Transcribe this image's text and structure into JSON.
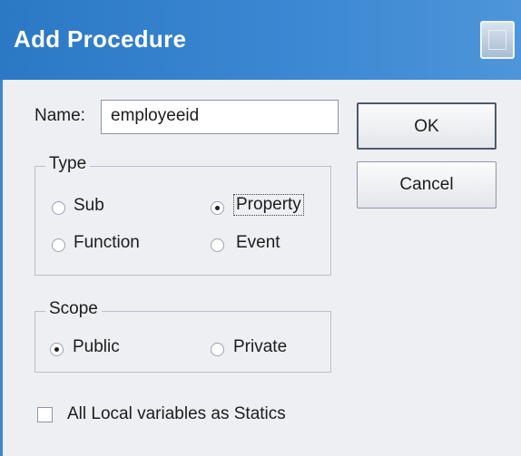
{
  "window": {
    "title": "Add Procedure"
  },
  "name_field": {
    "label": "Name:",
    "value": "employeeid"
  },
  "buttons": {
    "ok": "OK",
    "cancel": "Cancel"
  },
  "type_group": {
    "title": "Type",
    "options": [
      {
        "label": "Sub",
        "selected": false
      },
      {
        "label": "Property",
        "selected": true
      },
      {
        "label": "Function",
        "selected": false
      },
      {
        "label": "Event",
        "selected": false
      }
    ]
  },
  "scope_group": {
    "title": "Scope",
    "options": [
      {
        "label": "Public",
        "selected": true
      },
      {
        "label": "Private",
        "selected": false
      }
    ]
  },
  "statics_checkbox": {
    "label": "All Local variables as Statics",
    "checked": false
  }
}
